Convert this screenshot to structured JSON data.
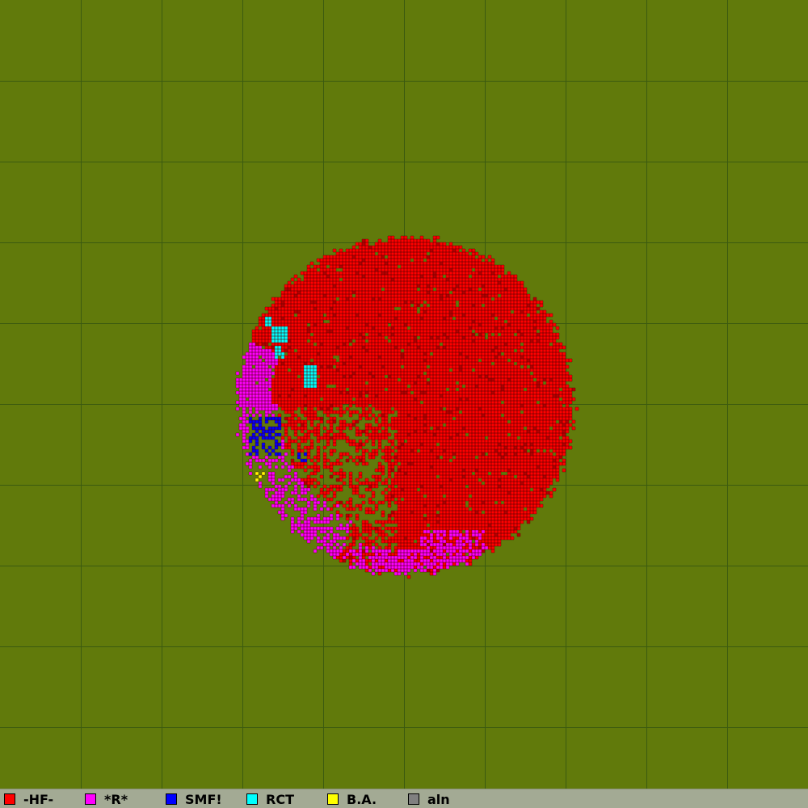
{
  "map": {
    "background": "#617a0b",
    "grid_color": "#3b5a10",
    "grid_cells": 10
  },
  "factions": [
    {
      "name": "-HF-",
      "color": "#ff0000"
    },
    {
      "name": "*R*",
      "color": "#ff00ff"
    },
    {
      "name": "SMF!",
      "color": "#0000ff"
    },
    {
      "name": "RCT",
      "color": "#00ffff"
    },
    {
      "name": "B.A.",
      "color": "#ffff00"
    },
    {
      "name": "aln",
      "color": "#808080"
    }
  ]
}
